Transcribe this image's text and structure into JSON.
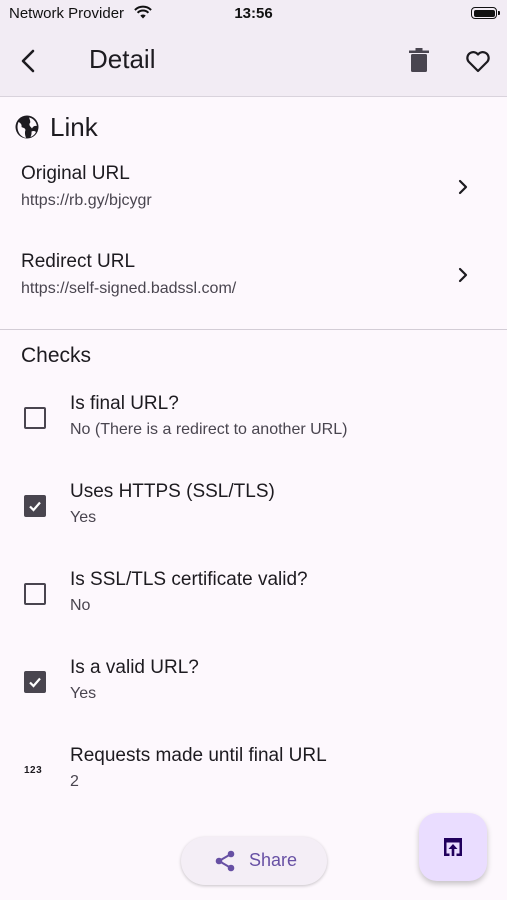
{
  "status_bar": {
    "carrier": "Network Provider",
    "time": "13:56"
  },
  "app_bar": {
    "title": "Detail",
    "icons": [
      "back-arrow-icon",
      "trash-icon",
      "heart-outline-icon"
    ]
  },
  "link_section": {
    "title": "Link",
    "icon": "globe-icon",
    "rows": [
      {
        "label": "Original URL",
        "value": "https://rb.gy/bjcygr"
      },
      {
        "label": "Redirect URL",
        "value": "https://self-signed.badssl.com/"
      }
    ]
  },
  "checks_section": {
    "title": "Checks",
    "items": [
      {
        "label": "Is final URL?",
        "value": "No (There is a redirect to another URL)",
        "checked": false
      },
      {
        "label": "Uses HTTPS (SSL/TLS)",
        "value": "Yes",
        "checked": true
      },
      {
        "label": "Is SSL/TLS certificate valid?",
        "value": "No",
        "checked": false
      },
      {
        "label": "Is a valid URL?",
        "value": "Yes",
        "checked": true
      },
      {
        "label": "Requests made until final URL",
        "value": "2",
        "icon_text": "123"
      }
    ]
  },
  "actions": {
    "share_label": "Share",
    "fab_icon": "open-in-browser-icon"
  },
  "colors": {
    "accent": "#6750a4",
    "fab_background": "#eaddff",
    "app_bar_background": "#f2ecf4"
  }
}
